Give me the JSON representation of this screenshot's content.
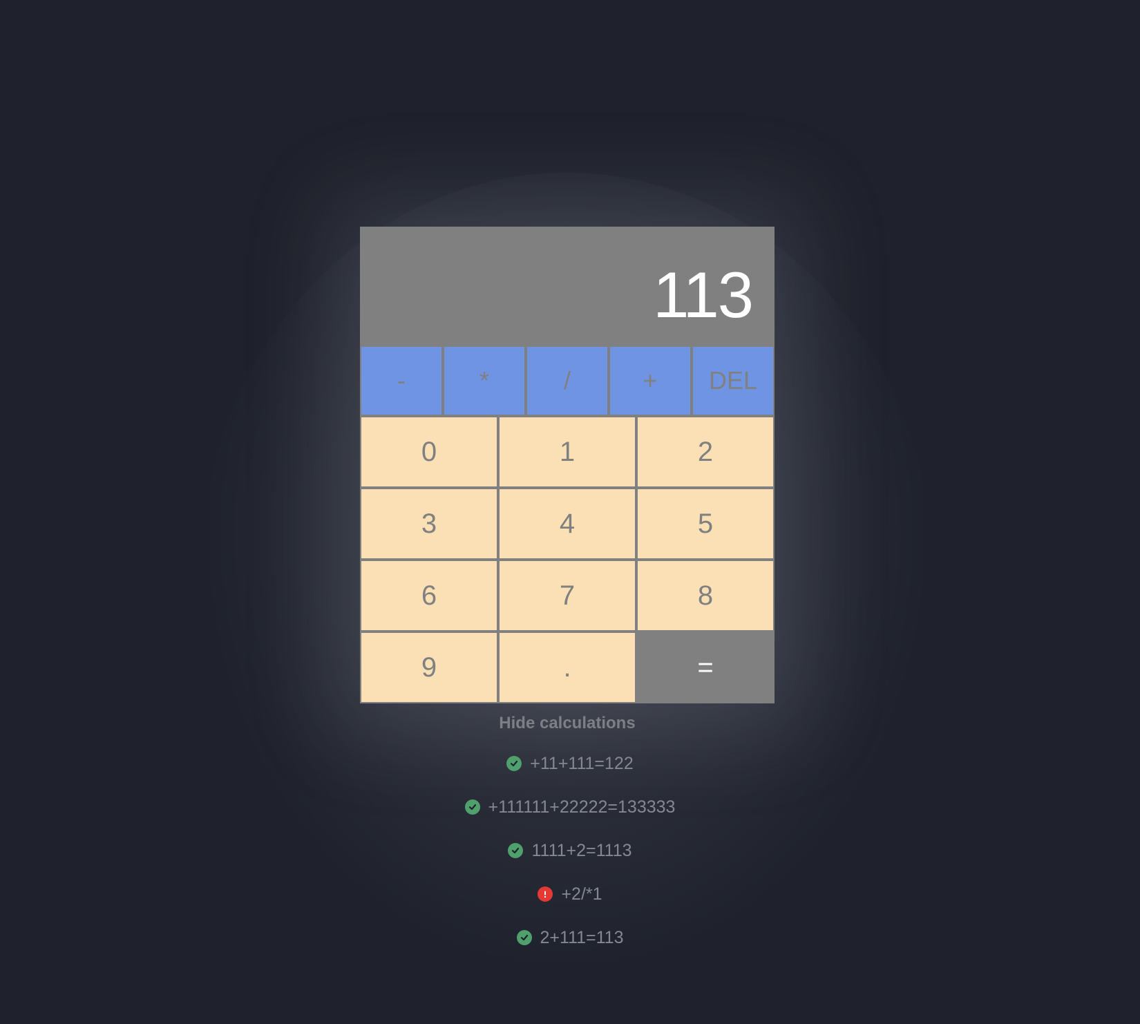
{
  "display": {
    "value": "113"
  },
  "operators": [
    "-",
    "*",
    "/",
    "+",
    "DEL"
  ],
  "digits": [
    "0",
    "1",
    "2",
    "3",
    "4",
    "5",
    "6",
    "7",
    "8",
    "9",
    "."
  ],
  "equals_label": "=",
  "toggle_label": "Hide calculations",
  "history": [
    {
      "expression": "+11+111=122",
      "status": "success",
      "icon": "check-circle-icon"
    },
    {
      "expression": "+111111+22222=133333",
      "status": "success",
      "icon": "check-circle-icon"
    },
    {
      "expression": "1111+2=1113",
      "status": "success",
      "icon": "check-circle-icon"
    },
    {
      "expression": "+2/*1",
      "status": "error",
      "icon": "error-circle-icon"
    },
    {
      "expression": "2+111=113",
      "status": "success",
      "icon": "check-circle-icon"
    }
  ],
  "colors": {
    "background": "#1f222c",
    "display": "#808080",
    "operator": "#7094e4",
    "digit": "#fae0b4",
    "equals": "#808080",
    "success": "#4fa06d",
    "error": "#e53935"
  }
}
